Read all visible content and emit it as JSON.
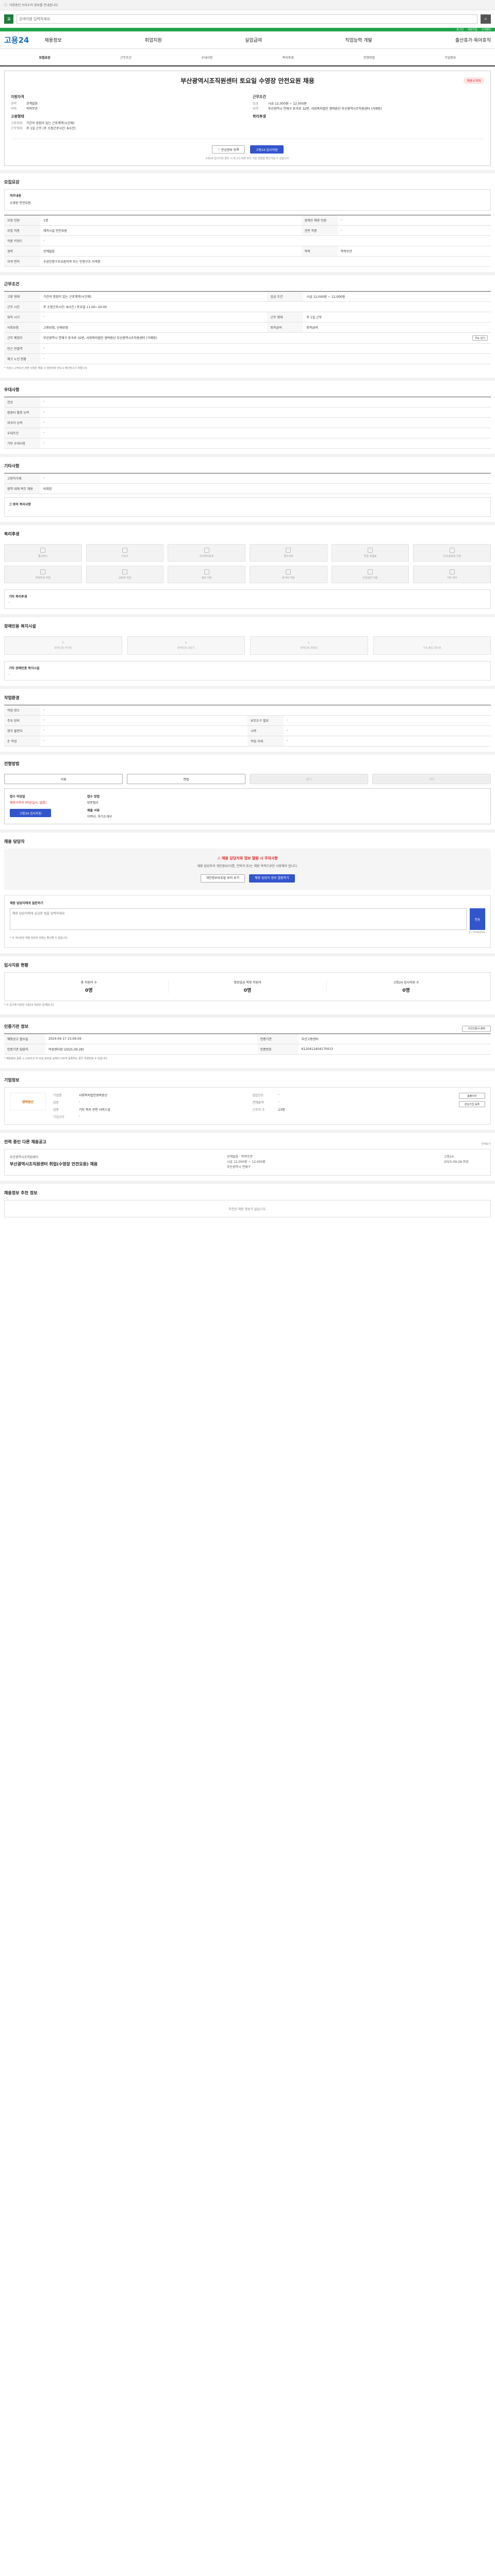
{
  "topbar": {
    "note": "이용중인 브라우저 정보를 안내합니다."
  },
  "search": {
    "placeholder": "검색어를 입력하세요",
    "logo": "고"
  },
  "greenbar": [
    "로그인",
    "회원가입",
    "고객센터"
  ],
  "gnb": {
    "brand": "고용24",
    "menu": [
      "채용정보",
      "취업지원",
      "실업급여",
      "직업능력 개발",
      "출산휴가·육아휴직"
    ]
  },
  "tabs": [
    "모집요강",
    "근무조건",
    "우대사항",
    "복리후생",
    "전형방법",
    "기업정보"
  ],
  "company": {
    "title": "부산광역시조직원센터 토요일 수영장 안전요원 채용",
    "badge": "채용시까지",
    "left_title": "지원자격",
    "left_rows": [
      {
        "k": "경력",
        "v": "관계없음"
      },
      {
        "k": "학력",
        "v": "학력무관"
      }
    ],
    "left_title2": "고용형태",
    "left_rows2": [
      {
        "k": "고용형태",
        "v": "기간의 정함이 있는 근로계약(시간제)"
      },
      {
        "k": "근무형태",
        "v": "주 1일 근무 (주 소정근로시간: 8시간)"
      }
    ],
    "right_title": "근무조건",
    "right_rows": [
      {
        "k": "임금",
        "v": "시급 12,000원 ~ 12,000원"
      },
      {
        "k": "지역",
        "v": "부산광역시 연제구 토곡로 32번, 사회복지법인 영락원산 부산광역시조직원센터 (거제동)"
      }
    ],
    "right_title2": "복리후생",
    "btn_scrap": "관심정보 등록",
    "btn_apply": "고용24 입사지원",
    "note": "고용24 입사지원 클릭 시 로그인 화면 후의 지원 현황을 확인하실 수 있습니다."
  },
  "recruit": {
    "title": "모집요강",
    "job_title_label": "직무내용",
    "job_title_value": "수영장 안전요원",
    "rows": [
      {
        "k": "모집 인원",
        "v": "1명",
        "k2": "장애인 채용 인원",
        "v2": "-"
      },
      {
        "k": "모집 직종",
        "v": "레저시설 안전요원",
        "k2": "관련 직종",
        "v2": "-"
      },
      {
        "k": "직종 키워드",
        "v": "-",
        "k2": "",
        "v2": ""
      },
      {
        "k": "경력",
        "v": "관계없음",
        "k2": "학력",
        "v2": "학력무관"
      },
      {
        "k": "자격 면허",
        "v": "수상인명구조요원자격 또는 인명구조 자격증",
        "k2": "",
        "v2": ""
      }
    ]
  },
  "work": {
    "title": "근무조건",
    "rows": [
      {
        "k": "고용 형태",
        "v": "기간의 정함이 있는 근로계약(시간제)",
        "k2": "임금 조건",
        "v2": "시급 12,000원 ~ 12,000원"
      },
      {
        "k": "근무 시간",
        "v": "주 소정근로시간: 8시간 / 토요일 11:00~20:00",
        "k2": "",
        "v2": ""
      },
      {
        "k": "퇴직 시기",
        "v": "-",
        "k2": "근무 형태",
        "v2": "주 1일 근무"
      },
      {
        "k": "사회보험",
        "v": "고용보험, 산재보험",
        "k2": "퇴직급여",
        "v2": "퇴직급여"
      },
      {
        "k": "근무 예정지",
        "v": "부산광역시 연제구 토곡로 32번, 사회복지법인 영락원산 부산광역시조직원센터 (거제동)",
        "k2": "",
        "v2": ""
      },
      {
        "k": "인근 전철역",
        "v": "-",
        "k2": "",
        "v2": ""
      },
      {
        "k": "체크 노선 현황",
        "v": "-",
        "k2": "",
        "v2": ""
      }
    ],
    "map_btn": "지도 보기",
    "note": "* 지원시 근무조건 관련 사항은 채용 시 담당자와 반드시 확인하시기 바랍니다."
  },
  "pref": {
    "title": "우대사항",
    "rows": [
      {
        "k": "전공",
        "v": "-"
      },
      {
        "k": "컴퓨터 활용 능력",
        "v": "-"
      },
      {
        "k": "외국어 능력",
        "v": "-"
      },
      {
        "k": "우대조건",
        "v": "-"
      },
      {
        "k": "기타 우대사항",
        "v": "-"
      }
    ]
  },
  "etc": {
    "title": "기타사항",
    "rows": [
      {
        "k": "고용허가제",
        "v": "-"
      },
      {
        "k": "병역 대체 복무 채용",
        "v": "비희망"
      }
    ],
    "box_title": "그 밖의 복리사항",
    "box_value": "-"
  },
  "welfare": {
    "title": "복리후생",
    "items": [
      "통근버스",
      "기숙사",
      "자녀학비보조",
      "경조사비",
      "연금 보험료",
      "사내 동호회 지원",
      "주택자금 지원",
      "교육비 지원",
      "설비 지원",
      "휴가비 지원",
      "건강검진 지원",
      "기타 복지"
    ],
    "box_title": "기타 복리후생",
    "box_value": "-"
  },
  "disabled": {
    "title": "장애인용 복지시설",
    "items": [
      "장애인용 주차장",
      "장애인용 승강기",
      "장애인용 화장실",
      "기숙 출입 경사로"
    ],
    "box_title": "기타 장애인용 복지시설",
    "box_value": "-"
  },
  "env": {
    "title": "작업환경",
    "rows": [
      {
        "k": "작업 장소",
        "v": "-",
        "k2": "",
        "v2": ""
      },
      {
        "k": "주요 장비",
        "v": "-",
        "k2": "보조도구 필요",
        "v2": "-"
      },
      {
        "k": "청각 불편자",
        "v": "-",
        "k2": "시력",
        "v2": "-"
      },
      {
        "k": "손 작업",
        "v": "-",
        "k2": "작업 자세",
        "v2": "-"
      }
    ]
  },
  "method": {
    "title": "전형방법",
    "buttons": [
      "서류",
      "면접",
      "필기",
      "기타"
    ],
    "apply_label": "접수 마감일",
    "apply_value": "채용시까지 (마감일시: 없음)",
    "apply_btn": "고용24 입사지원",
    "method_label": "접수 방법",
    "method_value": "방문접수",
    "docs_label": "제출 서류",
    "docs_value": "이력서, 자기소개서"
  },
  "manager": {
    "title": "채용 담당자",
    "warn": "채용 담당자와 정보 열람 시 주의사항",
    "text": "채용 담당자의 개인정보(이름, 연락처 등)는 채용 목적으로만 사용해야 합니다.",
    "btn1": "개인정보보호법 보러 보기",
    "btn2": "채용 담당자 정보 열람하기"
  },
  "qna": {
    "title": "채용 담당자에게 질문하기",
    "placeholder": "채용 담당자에게 궁금한 점을 입력하세요",
    "counter": "0 / 500bytes",
    "send": "전송",
    "notes": "* 이 게시판은 채용 담당자 외에는 확인할 수 없습니다."
  },
  "status": {
    "title": "입사지원 현황",
    "items": [
      {
        "label": "총 지원자 수",
        "value": "0명"
      },
      {
        "label": "희망임금 적정 지원자",
        "value": "0명"
      },
      {
        "label": "고용24 입사지원 수",
        "value": "0명"
      }
    ],
    "note": "* 이 공고에 지원한 고용24 회원만 집계합니다."
  },
  "record": {
    "title": "인증기관 정보",
    "print_btn": "구인인증서 출력",
    "rows": [
      {
        "k": "채용공고 접수일",
        "v": "2024-04-17 15:09:59",
        "k2": "인증기관",
        "v2": "부산고용센터"
      },
      {
        "k": "인증기관 담당자",
        "v": "여성센터장 (2025.09.28)",
        "k2": "인증번호",
        "v2": "K120412404170013"
      }
    ],
    "notes": "* 채용정보 등록 시 근로조건 및 모집 정보를 실제와 다르게 등록하는 경우 처벌받을 수 있습니다."
  },
  "corp": {
    "title": "기업정보",
    "logo": "영락원산",
    "rows": [
      {
        "k": "기업명",
        "v": "사회복지법인영락원산",
        "k2": "설립년도",
        "v2": "-"
      },
      {
        "k": "업종",
        "v": "-",
        "k2": "연매출액",
        "v2": "-"
      },
      {
        "k": "업종",
        "v": "기타 복지 관련 서비스업",
        "k2": "근로자 수",
        "v2": "23명"
      },
      {
        "k": "기업규모",
        "v": "-",
        "k2": "",
        "v2": ""
      }
    ],
    "btn1": "홈페이지",
    "btn2": "관심기업 등록"
  },
  "other": {
    "title": "전력 중인 다른 채용공고",
    "right": "전체보기",
    "company": "부산광역시조직원센터",
    "job": "부산광역시조직원센터 취업(수영장 안전요원) 채용",
    "meta": [
      "관계없음 · 학력무관",
      "시급 12,000원 ~ 12,000원",
      "부산광역시 연제구"
    ],
    "right_meta": [
      "고용24",
      "2025-09-28 마감"
    ]
  },
  "recommend": {
    "title": "채용정보 추천 정보",
    "empty": "추천된 채용 정보가 없습니다."
  }
}
